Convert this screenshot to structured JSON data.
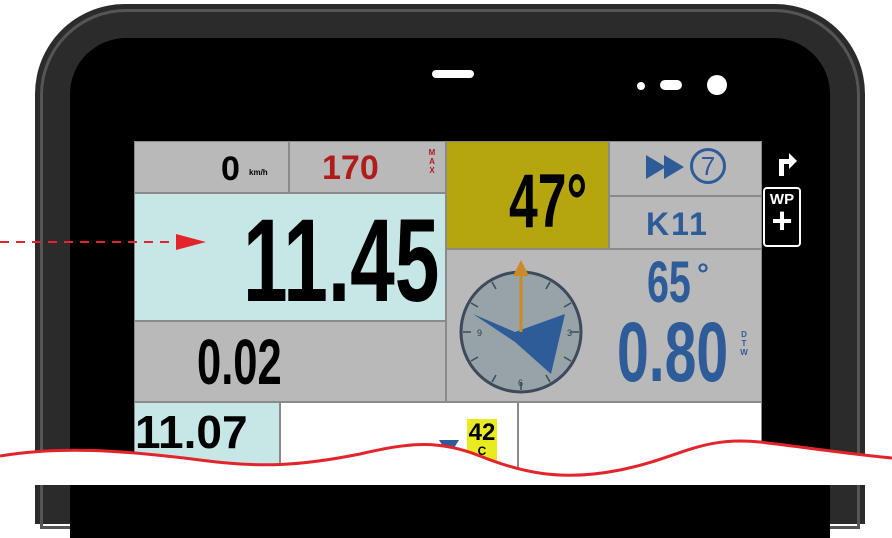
{
  "speed": {
    "current": "0",
    "unit": "km/h",
    "max": "170",
    "max_label": "MAX"
  },
  "main_distance": "11.45",
  "partial_distance": "0.02",
  "heading": {
    "value": "47",
    "unit": "°"
  },
  "next_waypoint": {
    "number": "7",
    "name": "K11"
  },
  "bearing": {
    "value": "65",
    "unit": "°"
  },
  "dtw": {
    "value": "0.80",
    "label": "DTW"
  },
  "compass": {
    "n": "9",
    "e": "3",
    "s": "6"
  },
  "bottom": {
    "distance": "11.07",
    "badge": "42",
    "badge_sub": "C"
  },
  "buttons": {
    "wp_label": "WP",
    "wp_plus": "+"
  },
  "colors": {
    "accent_red": "#e3242b",
    "blue": "#2e5c99",
    "yellow": "#eaea20",
    "light_cyan": "#c7e6e6",
    "olive": "#b5a60f"
  }
}
